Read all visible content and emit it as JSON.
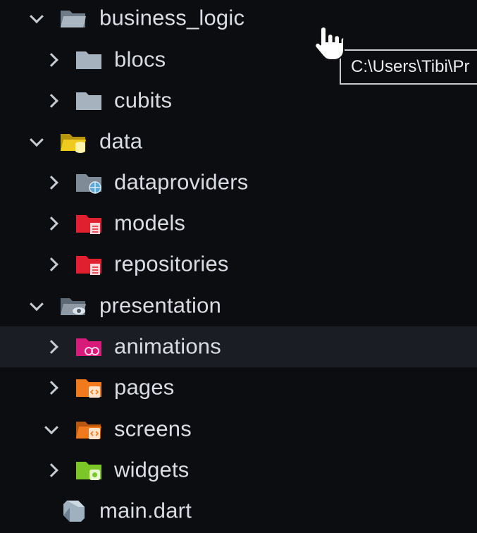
{
  "explorer": {
    "items": [
      {
        "label": "business_logic",
        "icon": "folder-open-icon",
        "expanded": true
      },
      {
        "label": "blocs",
        "icon": "folder-icon",
        "expanded": false
      },
      {
        "label": "cubits",
        "icon": "folder-icon",
        "expanded": false
      },
      {
        "label": "data",
        "icon": "folder-database-open-icon",
        "expanded": true
      },
      {
        "label": "dataproviders",
        "icon": "folder-globe-icon",
        "expanded": false
      },
      {
        "label": "models",
        "icon": "folder-models-icon",
        "expanded": false
      },
      {
        "label": "repositories",
        "icon": "folder-repository-icon",
        "expanded": false
      },
      {
        "label": "presentation",
        "icon": "folder-view-open-icon",
        "expanded": true
      },
      {
        "label": "animations",
        "icon": "folder-animation-icon",
        "expanded": false,
        "selected": true
      },
      {
        "label": "pages",
        "icon": "folder-html-icon",
        "expanded": false
      },
      {
        "label": "screens",
        "icon": "folder-html-open-icon",
        "expanded": true
      },
      {
        "label": "widgets",
        "icon": "folder-widget-icon",
        "expanded": false
      },
      {
        "label": "main.dart",
        "icon": "dart-file-icon"
      }
    ]
  },
  "tooltip": {
    "text": "C:\\Users\\Tibi\\Pr"
  },
  "colors": {
    "background": "#0c0d10",
    "selected_row": "#1a1d24",
    "folder_gray": "#8d9aa6",
    "folder_yellow": "#e8c21a",
    "folder_red": "#e0202f",
    "folder_magenta": "#d81b7a",
    "folder_orange": "#f07a1c",
    "folder_green": "#7cc628"
  }
}
